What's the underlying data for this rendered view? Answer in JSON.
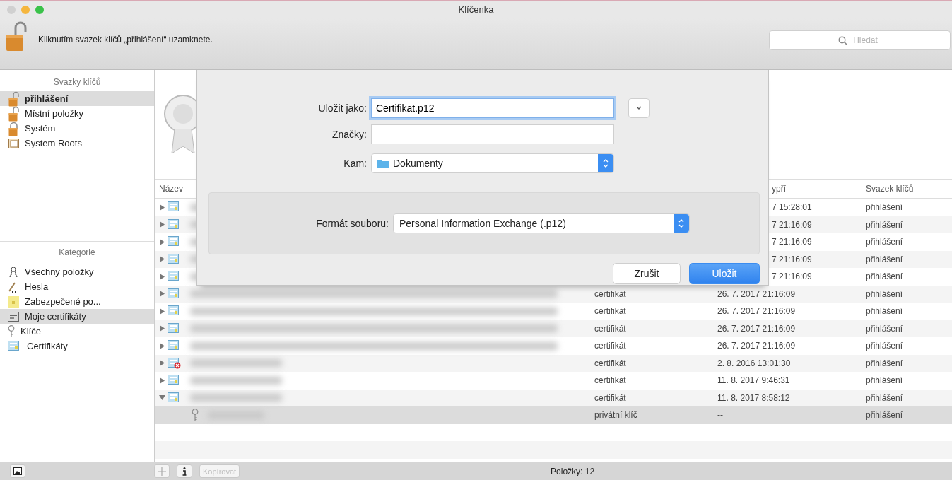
{
  "window": {
    "title": "Klíčenka"
  },
  "toolbar": {
    "locked": false,
    "message": "Kliknutím svazek klíčů „přihlášení“ uzamknete.",
    "search": {
      "placeholder": "Hledat"
    }
  },
  "sidebar": {
    "keychains_heading": "Svazky klíčů",
    "keychains": [
      {
        "label": "přihlášení",
        "kind": "unlocked",
        "selected": true
      },
      {
        "label": "Místní položky",
        "kind": "unlocked",
        "selected": false
      },
      {
        "label": "Systém",
        "kind": "locked",
        "selected": false
      },
      {
        "label": "System Roots",
        "kind": "cabinet",
        "selected": false
      }
    ],
    "categories_heading": "Kategorie",
    "categories": [
      {
        "label": "Všechny položky",
        "kind": "people",
        "selected": false
      },
      {
        "label": "Hesla",
        "kind": "pen",
        "selected": false
      },
      {
        "label": "Zabezpečené po...",
        "kind": "note",
        "selected": false
      },
      {
        "label": "Moje certifikáty",
        "kind": "card",
        "selected": true
      },
      {
        "label": "Klíče",
        "kind": "key",
        "selected": false
      },
      {
        "label": "Certifikáty",
        "kind": "certificate",
        "selected": false
      }
    ]
  },
  "table": {
    "column_headers": {
      "name": "Název",
      "expires": "ypří",
      "keychain": "Svazek klíčů"
    },
    "rows": [
      {
        "kind": "certificate",
        "invalid": false,
        "expanded": false,
        "selected": false,
        "expires": "7 15:28:01",
        "keychain": "přihlášení"
      },
      {
        "kind": "certificate",
        "invalid": false,
        "expanded": false,
        "selected": false,
        "expires": "7 21:16:09",
        "keychain": "přihlášení"
      },
      {
        "kind": "certificate",
        "invalid": false,
        "expanded": false,
        "selected": false,
        "expires": "7 21:16:09",
        "keychain": "přihlášení"
      },
      {
        "kind": "certificate",
        "invalid": false,
        "expanded": false,
        "selected": false,
        "expires": "7 21:16:09",
        "keychain": "přihlášení"
      },
      {
        "kind": "certificate",
        "invalid": false,
        "expanded": false,
        "selected": false,
        "expires": "7 21:16:09",
        "keychain": "přihlášení"
      },
      {
        "kind": "certificate",
        "invalid": false,
        "expanded": false,
        "selected": false,
        "item_type": "certifikát",
        "expires": "26. 7. 2017 21:16:09",
        "keychain": "přihlášení"
      },
      {
        "kind": "certificate",
        "invalid": false,
        "expanded": false,
        "selected": false,
        "item_type": "certifikát",
        "expires": "26. 7. 2017 21:16:09",
        "keychain": "přihlášení"
      },
      {
        "kind": "certificate",
        "invalid": false,
        "expanded": false,
        "selected": false,
        "item_type": "certifikát",
        "expires": "26. 7. 2017 21:16:09",
        "keychain": "přihlášení"
      },
      {
        "kind": "certificate",
        "invalid": false,
        "expanded": false,
        "selected": false,
        "item_type": "certifikát",
        "expires": "26. 7. 2017 21:16:09",
        "keychain": "přihlášení"
      },
      {
        "kind": "certificate",
        "invalid": true,
        "expanded": false,
        "selected": false,
        "item_type": "certifikát",
        "expires": "2. 8. 2016 13:01:30",
        "keychain": "přihlášení"
      },
      {
        "kind": "certificate",
        "invalid": false,
        "expanded": false,
        "selected": false,
        "item_type": "certifikát",
        "expires": "11. 8. 2017 9:46:31",
        "keychain": "přihlášení"
      },
      {
        "kind": "certificate",
        "invalid": false,
        "expanded": true,
        "selected": false,
        "item_type": "certifikát",
        "expires": "11. 8. 2017 8:58:12",
        "keychain": "přihlášení",
        "children": [
          {
            "kind": "key",
            "selected": true,
            "item_type": "privátní klíč",
            "expires": "--",
            "keychain": "přihlášení"
          }
        ]
      }
    ]
  },
  "dialog": {
    "save_as": {
      "label": "Uložit jako:",
      "value": "Certifikat.p12"
    },
    "tags": {
      "label": "Značky:"
    },
    "where": {
      "label": "Kam:",
      "value": "Dokumenty"
    },
    "format": {
      "label": "Formát souboru:",
      "value": "Personal Information Exchange (.p12)"
    },
    "buttons": [
      {
        "label": "Zrušit",
        "default": false
      },
      {
        "label": "Uložit",
        "default": true
      }
    ]
  },
  "bottom_bar": {
    "copy_button": {
      "label": "Kopírovat",
      "disabled": true
    },
    "status": "Položky: 12"
  }
}
